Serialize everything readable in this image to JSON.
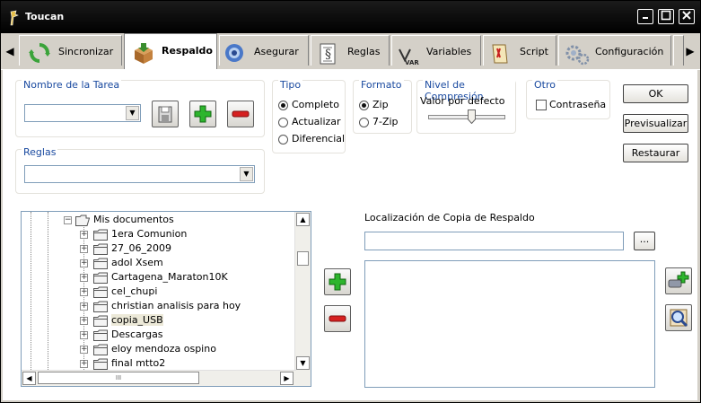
{
  "window": {
    "title": "Toucan"
  },
  "tabs": [
    {
      "label": "Sincronizar",
      "icon": "sync-icon"
    },
    {
      "label": "Respaldo",
      "icon": "backup-box-icon",
      "active": true
    },
    {
      "label": "Asegurar",
      "icon": "secure-shield-icon"
    },
    {
      "label": "Reglas",
      "icon": "rules-document-icon"
    },
    {
      "label": "Variables",
      "icon": "variables-icon"
    },
    {
      "label": "Script",
      "icon": "script-icon"
    },
    {
      "label": "Configuración",
      "icon": "gears-icon"
    }
  ],
  "task": {
    "title": "Nombre de la Tarea",
    "value": ""
  },
  "rules": {
    "title": "Reglas",
    "value": ""
  },
  "tipo": {
    "title": "Tipo",
    "options": [
      "Completo",
      "Actualizar",
      "Diferencial"
    ],
    "selected": "Completo"
  },
  "formato": {
    "title": "Formato",
    "options": [
      "Zip",
      "7-Zip"
    ],
    "selected": "Zip"
  },
  "compression": {
    "title": "Nivel de Compresión",
    "label": "Valor por defecto",
    "level": 0.5
  },
  "otro": {
    "title": "Otro",
    "password_label": "Contraseña",
    "password_checked": false
  },
  "buttons": {
    "ok": "OK",
    "preview": "Previsualizar",
    "restore": "Restaurar"
  },
  "location": {
    "label": "Localización de Copia de Respaldo",
    "value": "",
    "browse": "..."
  },
  "tree": {
    "root": "Mis documentos",
    "items": [
      "1era Comunion",
      "27_06_2009",
      "adol Xsem",
      "Cartagena_Maraton10K",
      "cel_chupi",
      "christian analisis para hoy",
      "copia_USB",
      "Descargas",
      "eloy mendoza ospino",
      "final mtto2"
    ],
    "selected": "copia_USB",
    "hscroll_grip": "III"
  },
  "colors": {
    "titlebar": "#000000",
    "group_title": "#1a4aa0",
    "add_green": "#2db52d",
    "remove_red": "#d62020"
  }
}
